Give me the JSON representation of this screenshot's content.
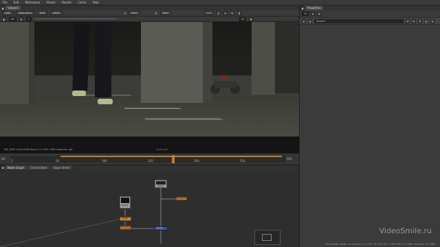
{
  "menubar": {
    "items": [
      "File",
      "Edit",
      "Workspace",
      "Viewer",
      "Render",
      "Cache",
      "Help"
    ]
  },
  "viewer": {
    "tab_label": "Viewer1",
    "channels": "rgba",
    "alpha_channel": "rgba.alpha",
    "colorspace": "RGB",
    "proxy": "sRGB",
    "input_a": "A",
    "input_a_node": "Dot1",
    "input_b": "B",
    "input_b_node": "Dot1",
    "zoom": "1:1",
    "frame_value": "1",
    "gain": "f/8",
    "gamma": "1",
    "left_num": "0",
    "right_num": "30"
  },
  "scene_info": {
    "format": "HD_1080 1920x1080  bbox: 0 0 1920 1080 channels: rgb",
    "coords": "x=0 y=0"
  },
  "timeline": {
    "left_frame": "64",
    "right_frame": "281",
    "ticks": [
      "1",
      "50",
      "100",
      "150",
      "200",
      "250"
    ],
    "current_frame": "178",
    "fps_label": "24*",
    "global_label": "Global",
    "step": "10",
    "end_frame": "217"
  },
  "properties": {
    "tab_label": "Properties",
    "max_panels": "10",
    "panel_name": "Viewer1"
  },
  "nodegraph": {
    "tabs": [
      "Node Graph",
      "Curve Editor",
      "Dope Sheet"
    ],
    "nodes": {
      "read_top": "Read1",
      "read_left": "Read2",
      "transform": "Transform1",
      "grade": "Grade1",
      "merge": "Merge1"
    }
  },
  "status": {
    "text": "Localization Mode: On  Memory: 3.4 GB (14.5%)  CPU: 7.9%  Disk: 0.0 MB/s  Network: 0.0 MB/s"
  },
  "watermark": "VideoSmile.ru",
  "colors": {
    "accent": "#c77a2a",
    "merge_node": "#3d4fa8",
    "transform_node": "#c9853a"
  }
}
